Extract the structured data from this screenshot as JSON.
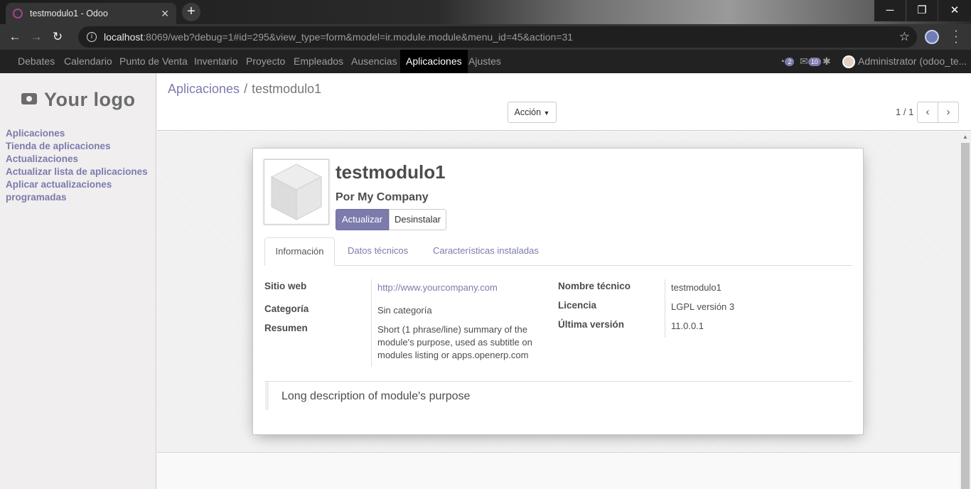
{
  "browser": {
    "tab_title": "testmodulo1 - Odoo",
    "url_host": "localhost",
    "url_rest": ":8069/web?debug=1#id=295&view_type=form&model=ir.module.module&menu_id=45&action=31"
  },
  "topnav": {
    "items": [
      "Debates",
      "Calendario",
      "Punto de Venta",
      "Inventario",
      "Proyecto",
      "Empleados",
      "Ausencias",
      "Aplicaciones",
      "Ajustes"
    ],
    "active": "Aplicaciones",
    "activity_count": "2",
    "message_count": "10",
    "user": "Administrator (odoo_te..."
  },
  "sidebar": {
    "logo_text": "Your logo",
    "menu": [
      "Aplicaciones",
      "Tienda de aplicaciones",
      "Actualizaciones",
      "Actualizar lista de aplicaciones",
      "Aplicar actualizaciones programadas"
    ]
  },
  "controlpanel": {
    "breadcrumb_parent": "Aplicaciones",
    "breadcrumb_sep": "/",
    "breadcrumb_current": "testmodulo1",
    "action_label": "Acción",
    "pager": "1 / 1"
  },
  "module": {
    "name": "testmodulo1",
    "author": "Por My Company",
    "btn_update": "Actualizar",
    "btn_uninstall": "Desinstalar",
    "tabs": [
      "Información",
      "Datos técnicos",
      "Características instaladas"
    ],
    "fields_left": [
      {
        "label": "Sitio web",
        "value": "http://www.yourcompany.com"
      },
      {
        "label": "Categoría",
        "value": "Sin categoría"
      },
      {
        "label": "Resumen",
        "value": "Short (1 phrase/line) summary of the module's purpose, used as subtitle on modules listing or apps.openerp.com"
      }
    ],
    "fields_right": [
      {
        "label": "Nombre técnico",
        "value": "testmodulo1"
      },
      {
        "label": "Licencia",
        "value": "LGPL versión 3"
      },
      {
        "label": "Última versión",
        "value": "11.0.0.1"
      }
    ],
    "description": "Long description of module's purpose"
  },
  "colors": {
    "brand": "#7c7bad",
    "navbar": "#222222"
  }
}
